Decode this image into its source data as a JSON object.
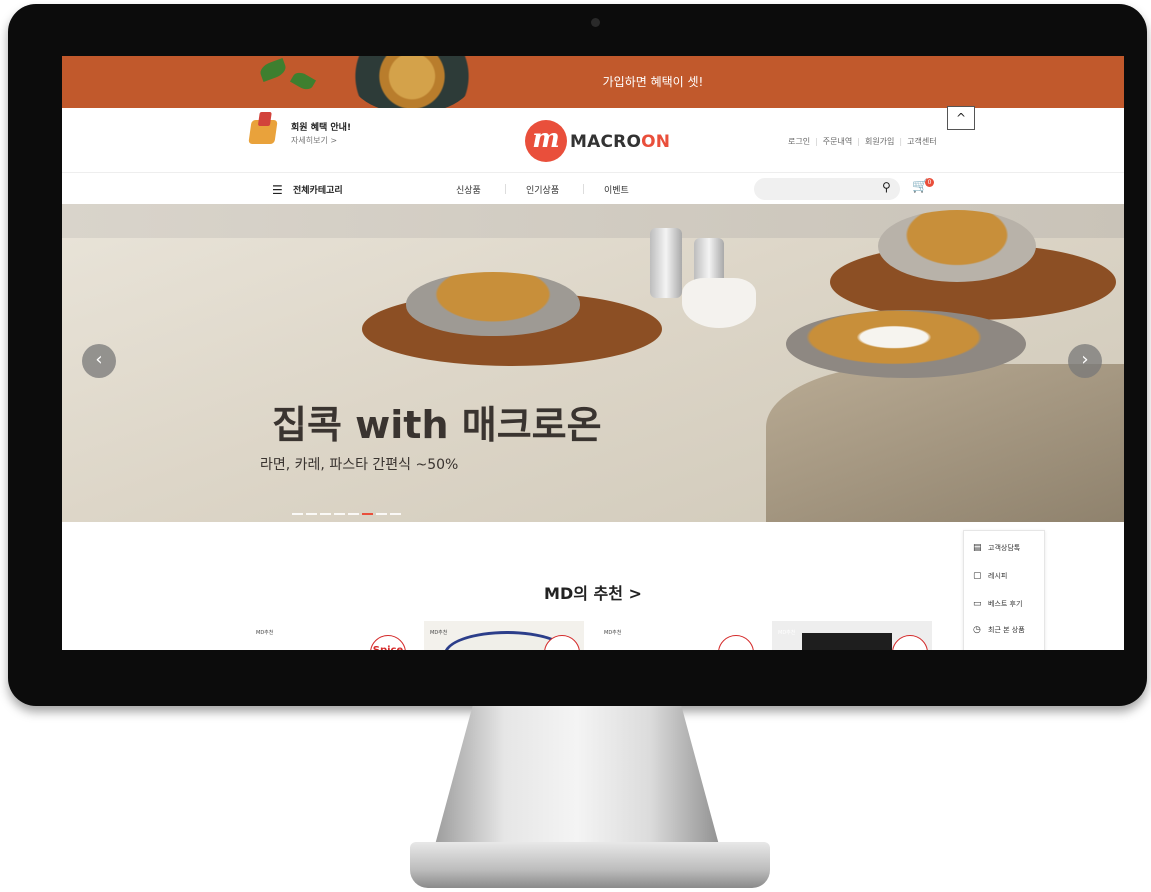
{
  "promo": {
    "text": "가입하면 혜택이 셋!"
  },
  "header": {
    "benefit_title": "회원 혜택 안내!",
    "benefit_more": "자세히보기 >",
    "logo_mark": "m",
    "logo_text_main": "MACRO",
    "logo_text_accent": "ON",
    "util_links": [
      "로그인",
      "주문내역",
      "회원가입",
      "고객센터"
    ],
    "top_button": "^"
  },
  "nav": {
    "menu_label": "전체카테고리",
    "items": [
      "신상품",
      "인기상품",
      "이벤트"
    ],
    "search_placeholder": "",
    "cart_count": "0"
  },
  "hero": {
    "title": "집콕 with 매크로온",
    "subtitle": "라면, 카레, 파스타 간편식 ~50%",
    "slide_count": 8,
    "active_slide": 6,
    "prev_arrow": "‹",
    "next_arrow": "›"
  },
  "recommend": {
    "title": "MD의 추천 >",
    "products": [
      {
        "tag": "MD추천",
        "brand": "Spice"
      },
      {
        "tag": "MD추천",
        "brand": ""
      },
      {
        "tag": "MD추천",
        "brand": ""
      },
      {
        "tag": "MD추천",
        "brand": ""
      }
    ]
  },
  "quick_panel": {
    "items": [
      {
        "label": "고객상담톡",
        "icon": "chat-icon"
      },
      {
        "label": "레시피",
        "icon": "recipe-icon"
      },
      {
        "label": "베스트 후기",
        "icon": "review-icon"
      },
      {
        "label": "최근 본 상품",
        "icon": "clock-icon"
      }
    ]
  },
  "colors": {
    "brand": "#e94f3b",
    "promo_bg": "#c1592c",
    "monitor": "#0c0c0c"
  }
}
